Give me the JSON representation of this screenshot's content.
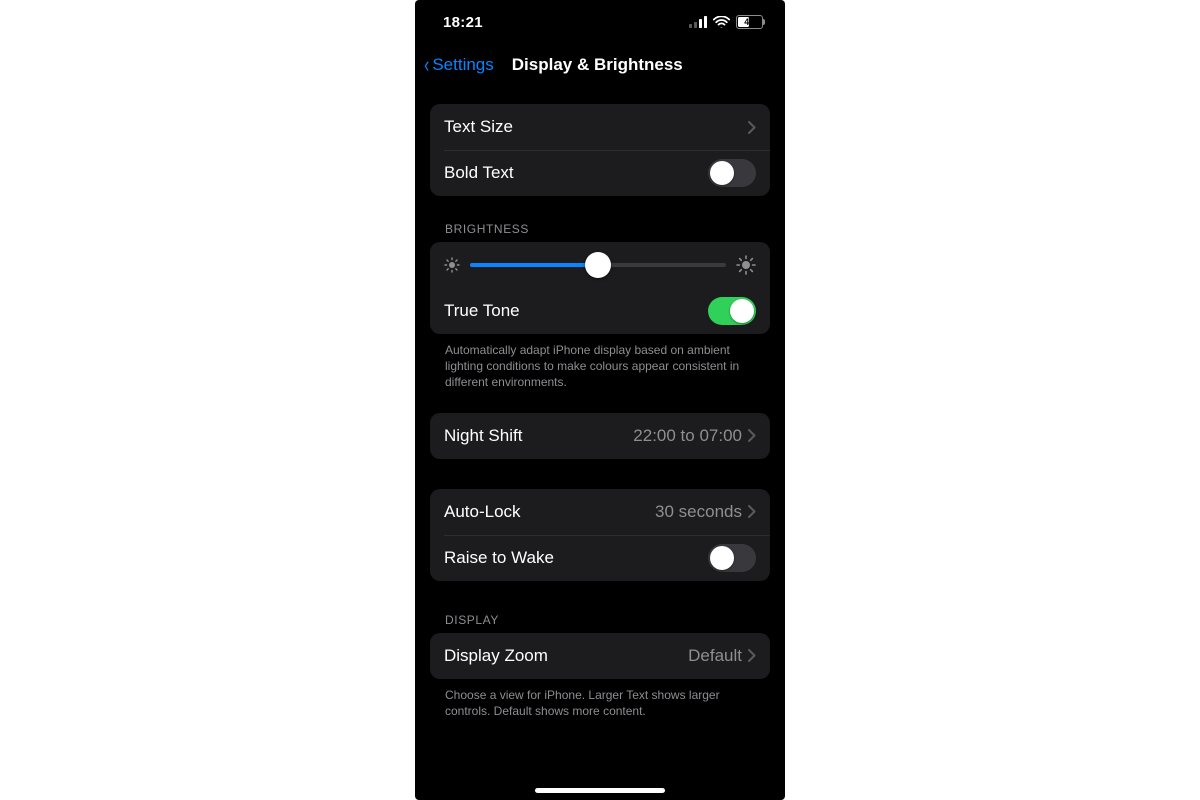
{
  "status": {
    "time": "18:21",
    "battery_pct": 47,
    "battery_fill_pct": 47
  },
  "nav": {
    "back_label": "Settings",
    "title": "Display & Brightness"
  },
  "text_group": {
    "text_size_label": "Text Size",
    "bold_text_label": "Bold Text",
    "bold_text_on": false
  },
  "brightness": {
    "header": "BRIGHTNESS",
    "level_pct": 50,
    "true_tone_label": "True Tone",
    "true_tone_on": true,
    "footer": "Automatically adapt iPhone display based on ambient lighting conditions to make colours appear consistent in different environments."
  },
  "night_shift": {
    "label": "Night Shift",
    "value": "22:00 to 07:00"
  },
  "lock_group": {
    "auto_lock_label": "Auto-Lock",
    "auto_lock_value": "30 seconds",
    "raise_to_wake_label": "Raise to Wake",
    "raise_to_wake_on": false
  },
  "display_group": {
    "header": "DISPLAY",
    "display_zoom_label": "Display Zoom",
    "display_zoom_value": "Default",
    "footer": "Choose a view for iPhone. Larger Text shows larger controls. Default shows more content."
  },
  "colors": {
    "accent_blue": "#0a84ff",
    "toggle_green": "#30d158",
    "cell_bg": "#1c1c1e",
    "secondary_text": "#8e8e93"
  }
}
